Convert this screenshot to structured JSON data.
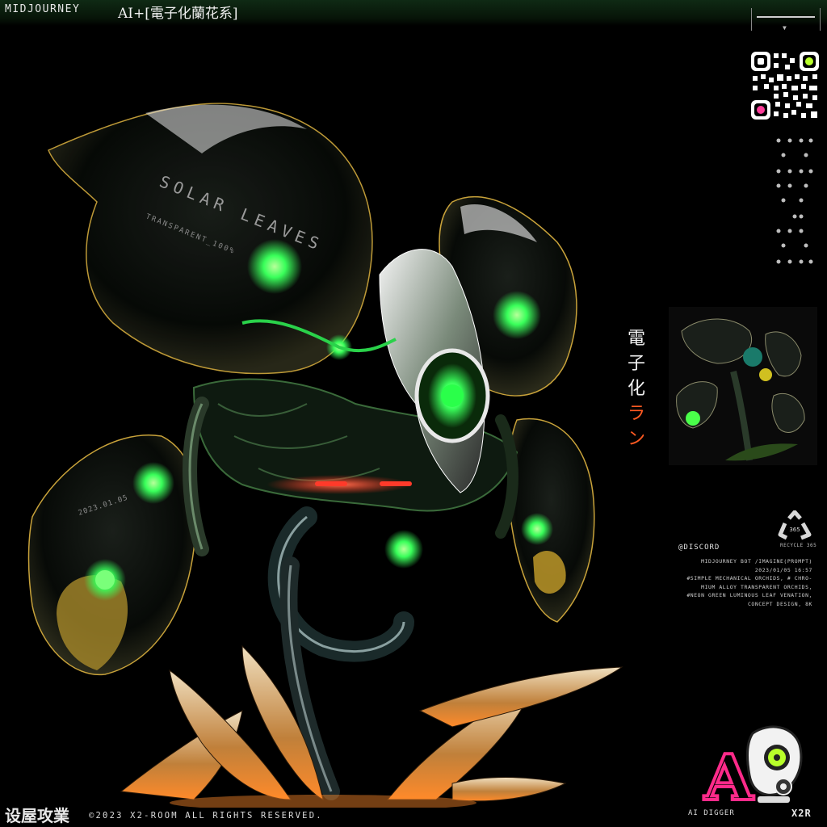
{
  "header": {
    "brand": "MIDJOURNEY",
    "title": "AI+[電子化蘭花系]"
  },
  "art": {
    "leaf_text_primary": "SOLAR LEAVES",
    "leaf_text_secondary": "TRANSPARENT_100%",
    "leaf_text_date": "2023.01.05",
    "accent_green": "#39ff5a",
    "accent_red": "#ff2a1a",
    "accent_orange": "#ff8a2a"
  },
  "sidebar": {
    "jp_title_kanji": "電子化",
    "jp_title_kana": "ラン",
    "recycle_number": "365",
    "recycle_label": "RECYCLE 365",
    "qr_accent_colors": [
      "#b8ff2a",
      "#ff3d9a"
    ]
  },
  "info": {
    "discord": "@DISCORD",
    "prompt_lines": [
      "MIDJOURNEY BOT /IMAGINE(PROMPT)",
      "2023/01/05 16:57",
      "#SIMPLE MECHANICAL ORCHIDS, # CHRO-",
      "MIUM ALLOY TRANSPARENT ORCHIDS,",
      "#NEON GREEN LUMINOUS LEAF VENATION,",
      "CONCEPT DESIGN, 8K"
    ]
  },
  "footer": {
    "studio": "设屋攻業",
    "copyright": "©2023 X2-ROOM ALL RIGHTS RESERVED.",
    "logo_label": "AI DIGGER",
    "logo_letter": "A",
    "brand_short": "X2R"
  }
}
